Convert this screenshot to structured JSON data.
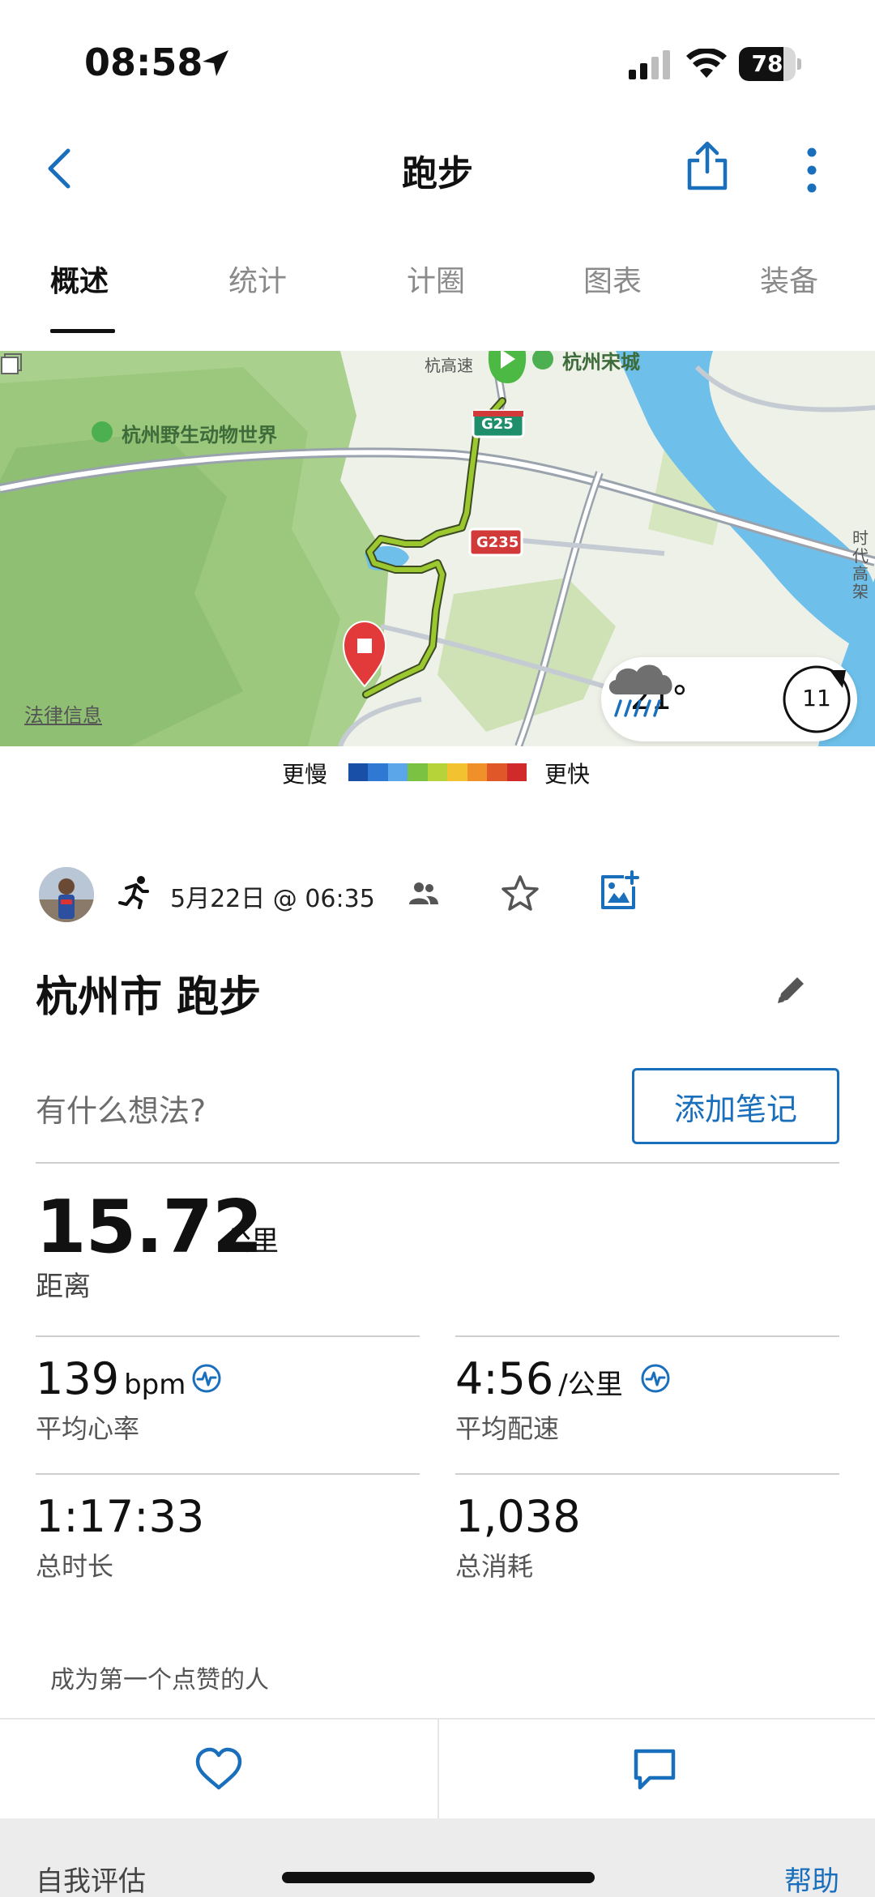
{
  "status_bar": {
    "time": "08:58",
    "battery_percent": "78",
    "battery_level": 0.78
  },
  "nav": {
    "title": "跑步",
    "back_icon": "chevron-left-icon",
    "share_icon": "share-icon",
    "more_icon": "more-vertical-icon"
  },
  "tabs": [
    {
      "label": "概述",
      "active": true
    },
    {
      "label": "统计",
      "active": false
    },
    {
      "label": "计圈",
      "active": false
    },
    {
      "label": "图表",
      "active": false
    },
    {
      "label": "装备",
      "active": false
    }
  ],
  "map": {
    "labels": {
      "zoo": "杭州野生动物世界",
      "songcheng": "杭州宋城",
      "g25": "G25",
      "g235": "G235",
      "expressway_fragment": "杭高速",
      "road_fragment": "时代高架"
    },
    "legal": "法律信息",
    "weather": {
      "temperature": "21°",
      "condition_icon": "rain-cloud-icon",
      "wind_speed": "11"
    }
  },
  "speed_legend": {
    "slow": "更慢",
    "fast": "更快",
    "colors": [
      "#1a4fa8",
      "#2f78d4",
      "#5aa6e8",
      "#7cc242",
      "#b6d33a",
      "#f2c230",
      "#f0902a",
      "#e0572a",
      "#d02a2a"
    ]
  },
  "activity": {
    "date_time": "5月22日 @ 06:35",
    "title": "杭州市 跑步",
    "note_prompt": "有什么想法?",
    "add_note_label": "添加笔记"
  },
  "stats": {
    "distance": {
      "value": "15.72",
      "unit": "公里",
      "label": "距离"
    },
    "heart_rate": {
      "value": "139",
      "unit": "bpm",
      "label": "平均心率"
    },
    "pace": {
      "value": "4:56",
      "unit": "/公里",
      "label": "平均配速"
    },
    "duration": {
      "value": "1:17:33",
      "label": "总时长"
    },
    "calories": {
      "value": "1,038",
      "label": "总消耗"
    }
  },
  "social": {
    "like_prompt": "成为第一个点赞的人"
  },
  "footer": {
    "self_eval": "自我评估",
    "help": "帮助"
  },
  "colors": {
    "accent_blue": "#1a6fbd",
    "route_green": "#9cc82f",
    "pin_red": "#e23a3a",
    "start_green": "#4cb944"
  }
}
